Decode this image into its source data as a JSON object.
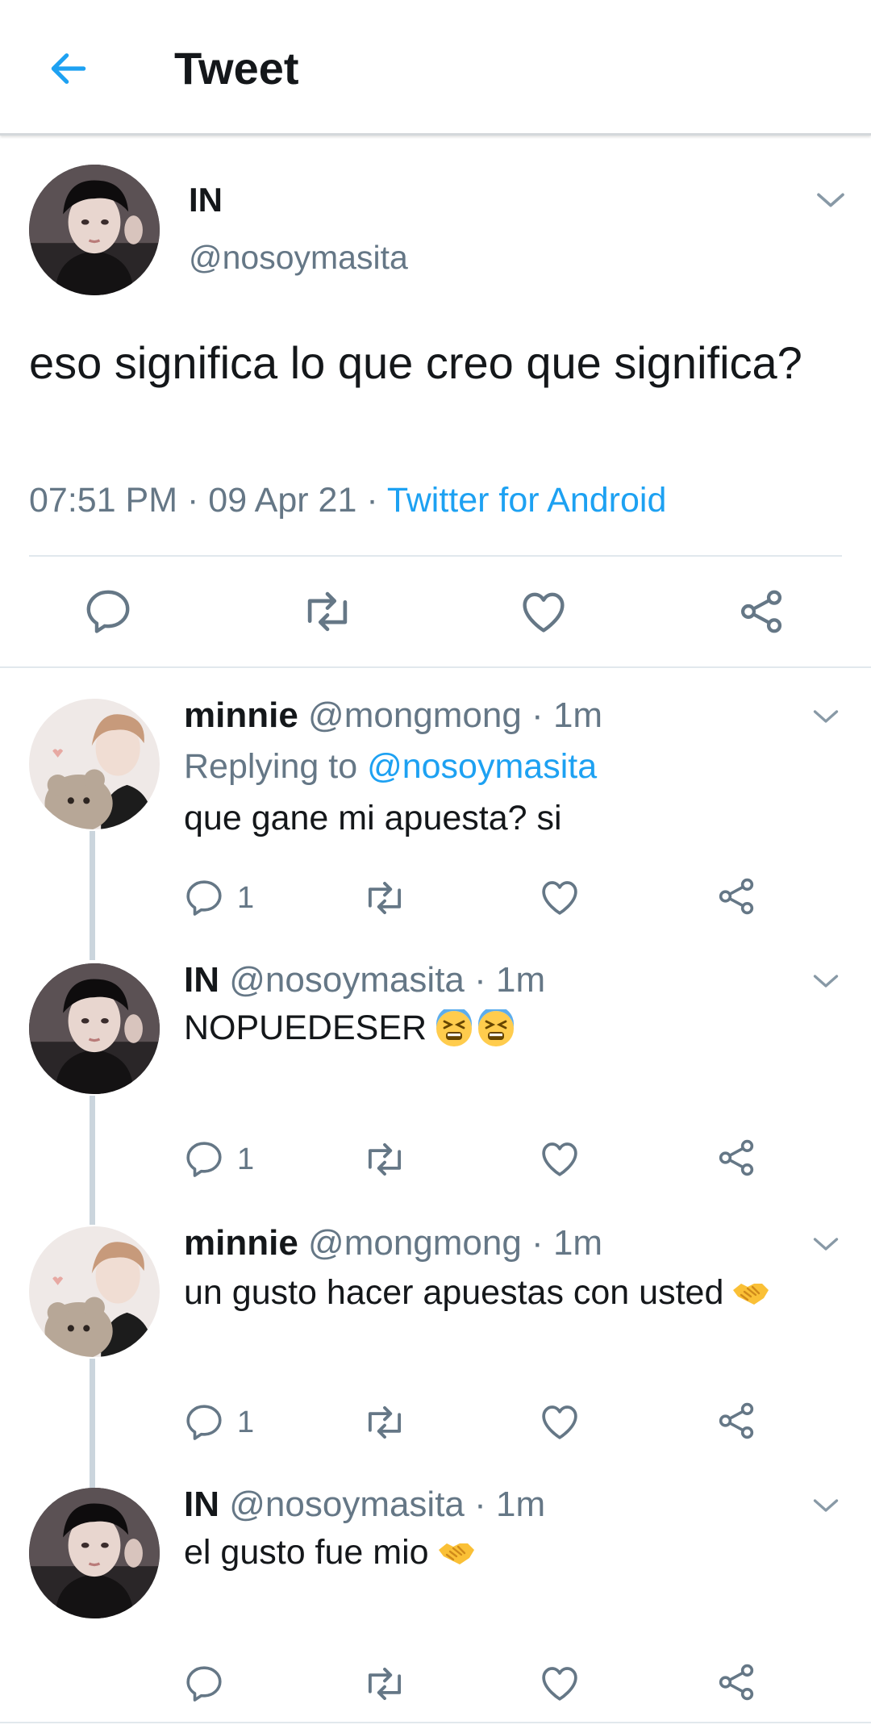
{
  "header": {
    "title": "Tweet"
  },
  "main_tweet": {
    "name": "IN",
    "handle": "@nosoymasita",
    "text": "eso significa lo que creo que significa?",
    "time": "07:51 PM",
    "date": "09 Apr 21",
    "separator": " · ",
    "source": "Twitter for Android"
  },
  "replies": [
    {
      "name": "minnie",
      "handle": "@mongmong",
      "time": "1m",
      "replying_prefix": "Replying to ",
      "replying_to": "@nosoymasita",
      "text": "que gane mi apuesta? si",
      "reply_count": "1",
      "emoji": ""
    },
    {
      "name": "IN",
      "handle": "@nosoymasita",
      "time": "1m",
      "text": "NOPUEDESER",
      "reply_count": "1",
      "emoji": "tired-face-emoji x2"
    },
    {
      "name": "minnie",
      "handle": "@mongmong",
      "time": "1m",
      "text": "un gusto hacer apuestas con usted",
      "reply_count": "1",
      "emoji": "handshake-emoji"
    },
    {
      "name": "IN",
      "handle": "@nosoymasita",
      "time": "1m",
      "text": "el gusto fue mio",
      "reply_count": "",
      "emoji": "handshake-emoji"
    }
  ],
  "colors": {
    "accent": "#1da1f2",
    "secondary_text": "#657786",
    "primary_text": "#14171a",
    "thread_line": "#cbd5dd"
  },
  "icons": [
    "back-arrow-icon",
    "chevron-down-icon",
    "reply-icon",
    "retweet-icon",
    "like-icon",
    "share-icon"
  ]
}
